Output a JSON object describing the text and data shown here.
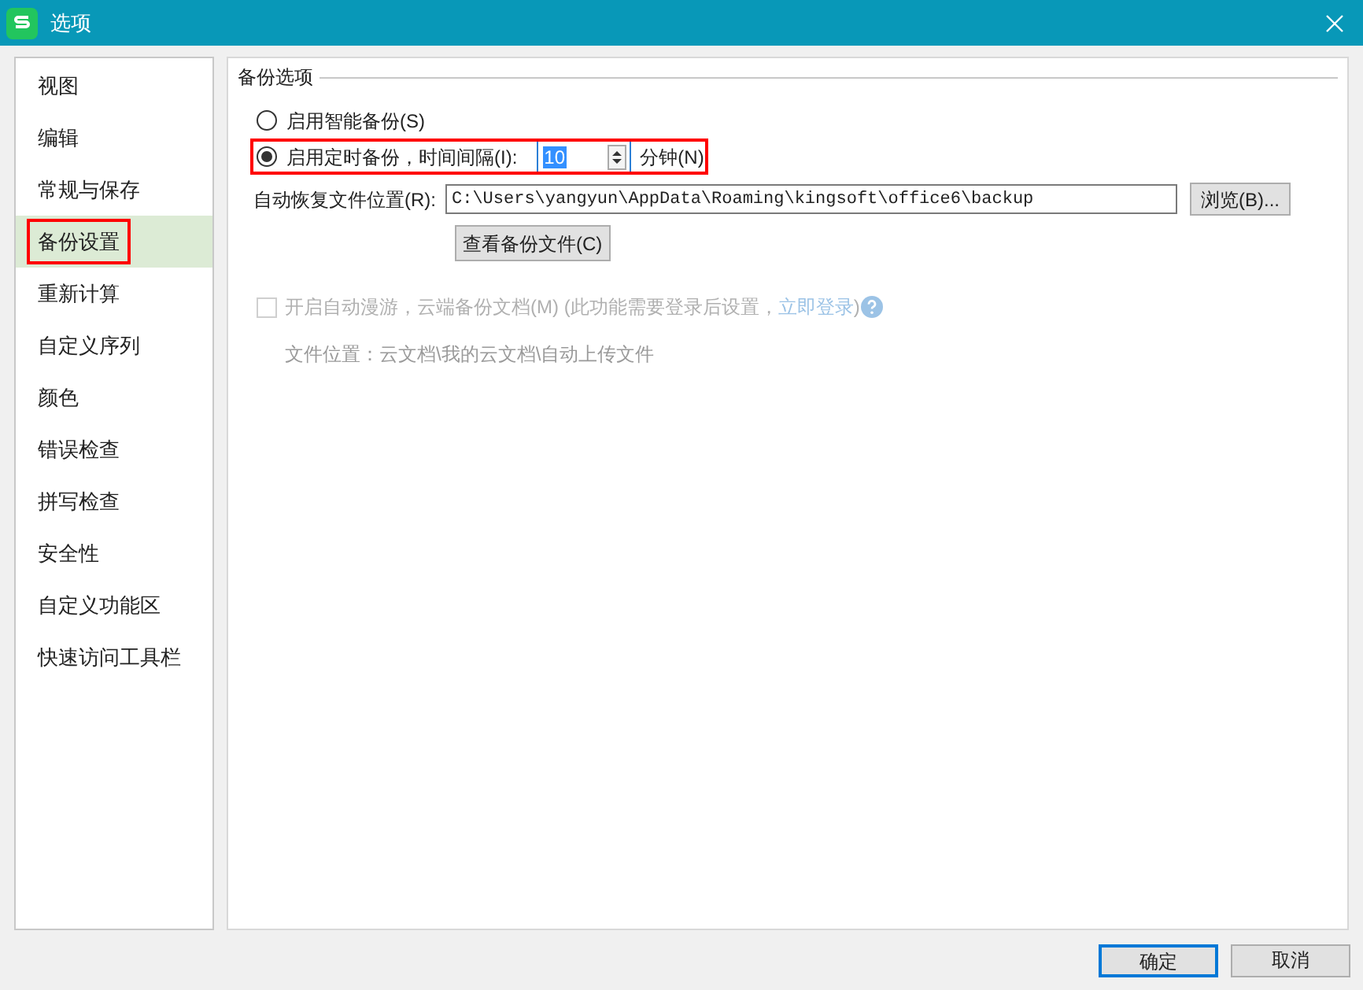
{
  "window": {
    "title": "选项"
  },
  "sidebar": {
    "items": [
      {
        "label": "视图",
        "selected": false,
        "highlighted": false
      },
      {
        "label": "编辑",
        "selected": false,
        "highlighted": false
      },
      {
        "label": "常规与保存",
        "selected": false,
        "highlighted": false
      },
      {
        "label": "备份设置",
        "selected": true,
        "highlighted": true
      },
      {
        "label": "重新计算",
        "selected": false,
        "highlighted": false
      },
      {
        "label": "自定义序列",
        "selected": false,
        "highlighted": false
      },
      {
        "label": "颜色",
        "selected": false,
        "highlighted": false
      },
      {
        "label": "错误检查",
        "selected": false,
        "highlighted": false
      },
      {
        "label": "拼写检查",
        "selected": false,
        "highlighted": false
      },
      {
        "label": "安全性",
        "selected": false,
        "highlighted": false
      },
      {
        "label": "自定义功能区",
        "selected": false,
        "highlighted": false
      },
      {
        "label": "快速访问工具栏",
        "selected": false,
        "highlighted": false
      }
    ]
  },
  "group": {
    "title": "备份选项",
    "radios": [
      {
        "label": "启用智能备份(S)",
        "selected": false,
        "highlighted": false
      },
      {
        "label": "启用定时备份，时间间隔(I):",
        "selected": true,
        "highlighted": true,
        "interval": {
          "value": "10",
          "unit": "分钟(N)"
        }
      }
    ],
    "location": {
      "label": "自动恢复文件位置(R):",
      "value": "C:\\Users\\yangyun\\AppData\\Roaming\\kingsoft\\office6\\backup",
      "browse": "浏览(B)..."
    },
    "view_button": "查看备份文件(C)",
    "cloud": {
      "checked": false,
      "disabled": true,
      "text": "开启自动漫游，云端备份文档(M) (此功能需要登录后设置，",
      "link": "立即登录",
      "after": ")",
      "location": "文件位置：云文档\\我的云文档\\自动上传文件"
    }
  },
  "buttons": [
    {
      "label": "确定",
      "default": true
    },
    {
      "label": "取消",
      "default": false
    }
  ]
}
